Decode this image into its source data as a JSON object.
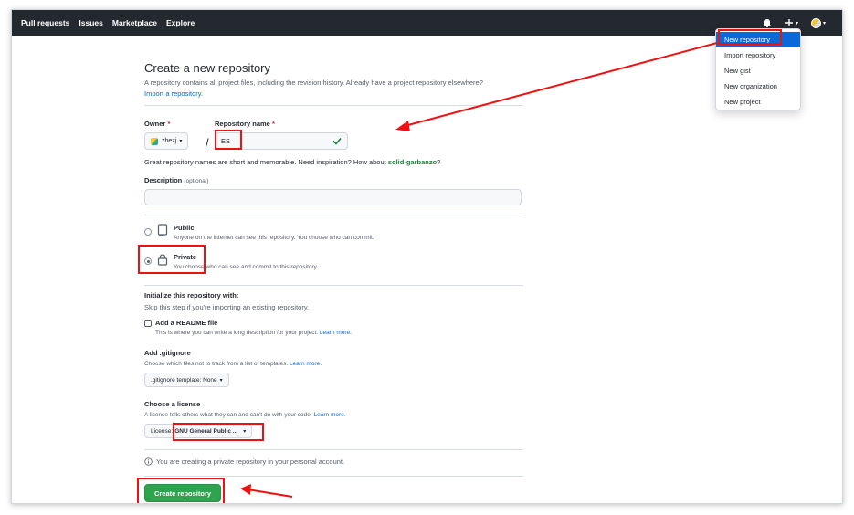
{
  "nav": {
    "items": [
      "Pull requests",
      "Issues",
      "Marketplace",
      "Explore"
    ]
  },
  "topbar": {
    "bell_icon": "bell-icon",
    "plus_icon": "plus-icon",
    "caret": "▾"
  },
  "dropdown": {
    "items": [
      "New repository",
      "Import repository",
      "New gist",
      "New organization",
      "New project"
    ]
  },
  "page": {
    "title": "Create a new repository",
    "intro_line1": "A repository contains all project files, including the revision history. Already have a project repository elsewhere?",
    "import_link": "Import a repository."
  },
  "owner": {
    "label": "Owner",
    "required_mark": "*",
    "value": "zbezj"
  },
  "repo": {
    "label": "Repository name",
    "required_mark": "*",
    "value": "ES",
    "slash": "/"
  },
  "hint": {
    "text": "Great repository names are short and memorable. Need inspiration? How about",
    "suggestion": "solid-garbanzo",
    "end": "?"
  },
  "description": {
    "label": "Description",
    "optional": "(optional)",
    "value": ""
  },
  "visibility": {
    "public_label": "Public",
    "public_desc": "Anyone on the internet can see this repository. You choose who can commit.",
    "private_label": "Private",
    "private_desc": "You choose who can see and commit to this repository.",
    "selected": "Private"
  },
  "init": {
    "title": "Initialize this repository with:",
    "subtitle": "Skip this step if you're importing an existing repository.",
    "readme_label": "Add a README file",
    "readme_desc": "This is where you can write a long description for your project.",
    "learn_more": "Learn more."
  },
  "gitignore": {
    "title": "Add .gitignore",
    "desc": "Choose which files not to track from a list of templates.",
    "learn_more": "Learn more.",
    "button": ".gitignore template: None"
  },
  "license": {
    "title": "Choose a license",
    "desc": "A license tells others what they can and can't do with your code.",
    "learn_more": "Learn more.",
    "prefix": "License:",
    "value": "GNU General Public ..."
  },
  "notice": {
    "text": "You are creating a private repository in your personal account."
  },
  "submit": {
    "label": "Create repository"
  },
  "colors": {
    "annotation": "#e11111",
    "primary": "#2da44e",
    "link": "#0969da",
    "topbar": "#24292f"
  }
}
